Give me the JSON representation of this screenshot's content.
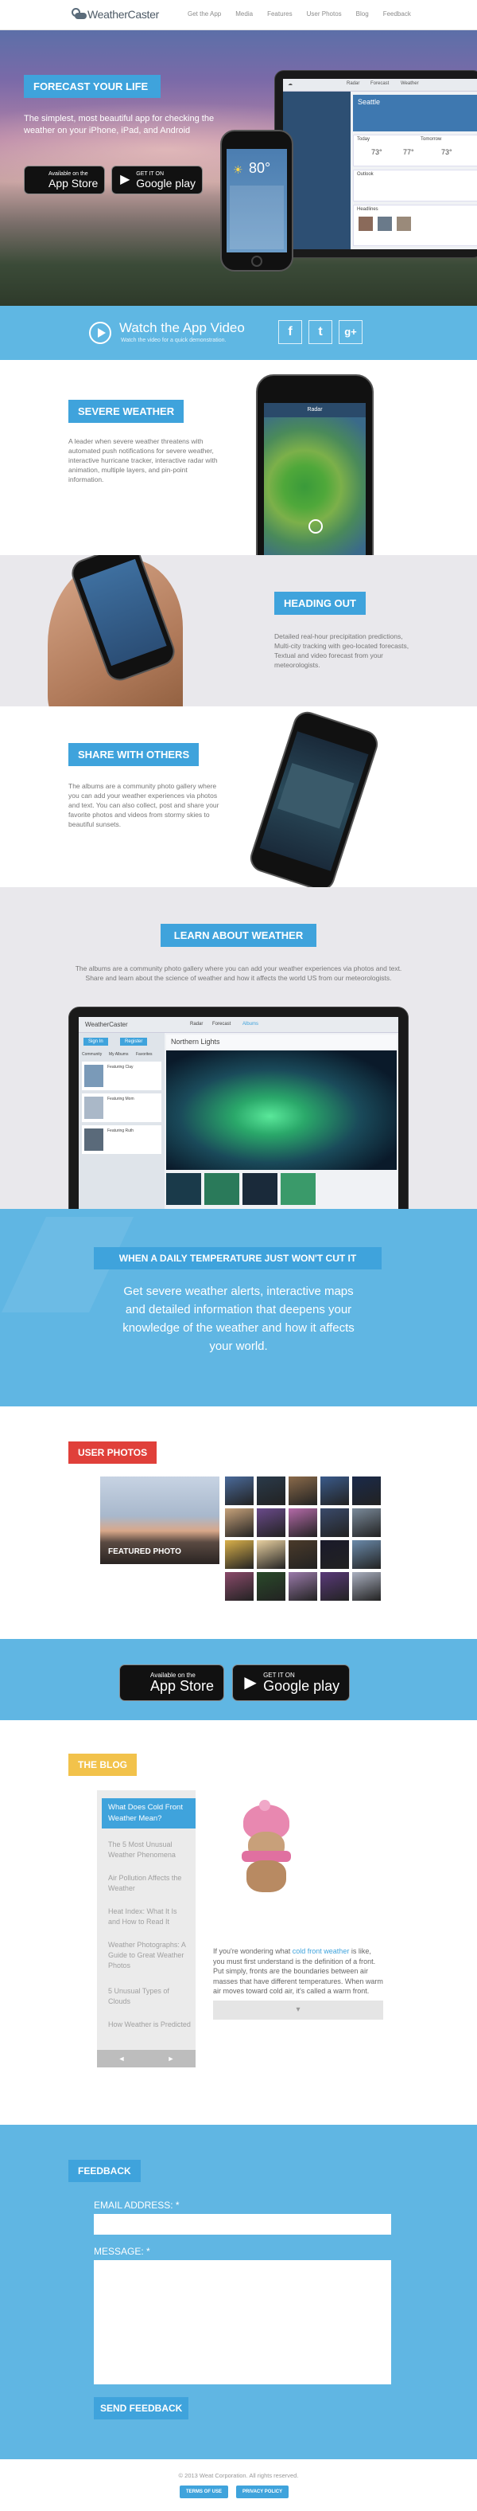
{
  "nav": {
    "logo": "WeatherCaster",
    "links": [
      "Get the App",
      "Media",
      "Features",
      "User Photos",
      "Blog",
      "Feedback"
    ]
  },
  "hero": {
    "title": "FORECAST YOUR LIFE",
    "subtitle": "The simplest, most beautiful app for checking the weather on your iPhone, iPad, and Android",
    "app_store_small": "Available on the",
    "app_store_big": "App Store",
    "google_small": "GET IT ON",
    "google_big": "Google play",
    "phone_temp": "80°",
    "tablet_city": "Seattle",
    "tablet_tabs": [
      "Radar",
      "Forecast",
      "Weather"
    ],
    "tablet_temps": [
      "73°",
      "77°",
      "73°"
    ],
    "tablet_labels": [
      "Today",
      "Tomorrow",
      "Outlook",
      "Headlines"
    ]
  },
  "video": {
    "title": "Watch the App Video",
    "subtitle": "Watch the video for a quick demonstration.",
    "social": [
      "f",
      "t",
      "g+"
    ]
  },
  "severe": {
    "title": "SEVERE WEATHER",
    "text": "A leader when severe weather threatens with automated push notifications for severe weather, interactive hurricane tracker, interactive radar with animation, multiple layers, and pin-point information.",
    "phone_title": "Radar"
  },
  "heading_out": {
    "title": "HEADING OUT",
    "text": "Detailed real-hour precipitation predictions, Multi-city tracking with geo-located forecasts, Textual and video forecast from your meteorologists."
  },
  "share": {
    "title": "SHARE WITH OTHERS",
    "text": "The albums are a community photo gallery where you can add your weather experiences via photos and text. You can also collect, post and share your favorite photos and videos from stormy skies to beautiful sunsets."
  },
  "learn": {
    "title": "LEARN ABOUT WEATHER",
    "text": "The albums are a community photo gallery where you can add your weather experiences via photos and text. Share and learn about the science of weather and how it affects the world US from our meteorologists.",
    "tablet_logo": "WeatherCaster",
    "tablet_tabs": [
      "Radar",
      "Forecast",
      "Albums"
    ],
    "album_title": "Northern Lights",
    "btn_signin": "Sign In",
    "btn_register": "Register",
    "filters": [
      "Community",
      "My Albums",
      "Favorites"
    ],
    "list_items": [
      "Featuring Clay",
      "Featuring Mom",
      "Featuring Ruth"
    ]
  },
  "daily": {
    "title": "WHEN A DAILY TEMPERATURE JUST WON'T CUT IT",
    "text": "Get severe weather alerts, interactive maps and detailed information that deepens your knowledge of the weather and how it affects your world."
  },
  "user_photos": {
    "title": "USER PHOTOS",
    "featured": "FEATURED PHOTO",
    "thumb_colors": [
      "#4a6a9a",
      "#2a3a4a",
      "#8a6a4a",
      "#3a5a8a",
      "#1a2a4a",
      "#c7a27a",
      "#6a4a8a",
      "#b46aa8",
      "#3a4a6a",
      "#7a8a9a",
      "#d9b04a",
      "#e8d0a0",
      "#4a3a2a",
      "#1a1a2a",
      "#6a8aaa",
      "#8a4a6a",
      "#2a4a2a",
      "#9a7aaa",
      "#5a3a7a",
      "#aab0c0"
    ]
  },
  "store_band": {
    "app_store_small": "Available on the",
    "app_store_big": "App Store",
    "google_small": "GET IT ON",
    "google_big": "Google play"
  },
  "blog": {
    "title": "THE BLOG",
    "active_post": "What Does Cold Front Weather Mean?",
    "posts": [
      "The 5 Most Unusual Weather Phenomena",
      "Air Pollution Affects the Weather",
      "Heat Index: What It Is and How to Read It",
      "Weather Photographs: A Guide to Great Weather Photos",
      "5 Unusual Types of Clouds",
      "How Weather is Predicted"
    ],
    "nav_prev": "◄",
    "nav_next": "►",
    "text_before": "If you're wondering what ",
    "text_link": "cold front weather",
    "text_after": " is like, you must first understand is the definition of a front. Put simply, fronts are the boundaries between air masses that have different temperatures. When warm air moves toward cold air, it's called a warm front. Likewise, when cold air moves toward warm air, it's a cold front.",
    "more": "▾"
  },
  "feedback": {
    "title": "FEEDBACK",
    "email_label": "EMAIL ADDRESS: *",
    "message_label": "MESSAGE: *",
    "send": "SEND FEEDBACK"
  },
  "footer": {
    "copyright": "© 2013 Weat Corporation. All rights reserved.",
    "terms": "TERMS OF USE",
    "privacy": "PRIVACY POLICY"
  },
  "colors": {
    "accent_blue": "#3fa3dc",
    "band_blue": "#60b6e3",
    "red": "#e0403a",
    "yellow": "#f2c24b"
  }
}
